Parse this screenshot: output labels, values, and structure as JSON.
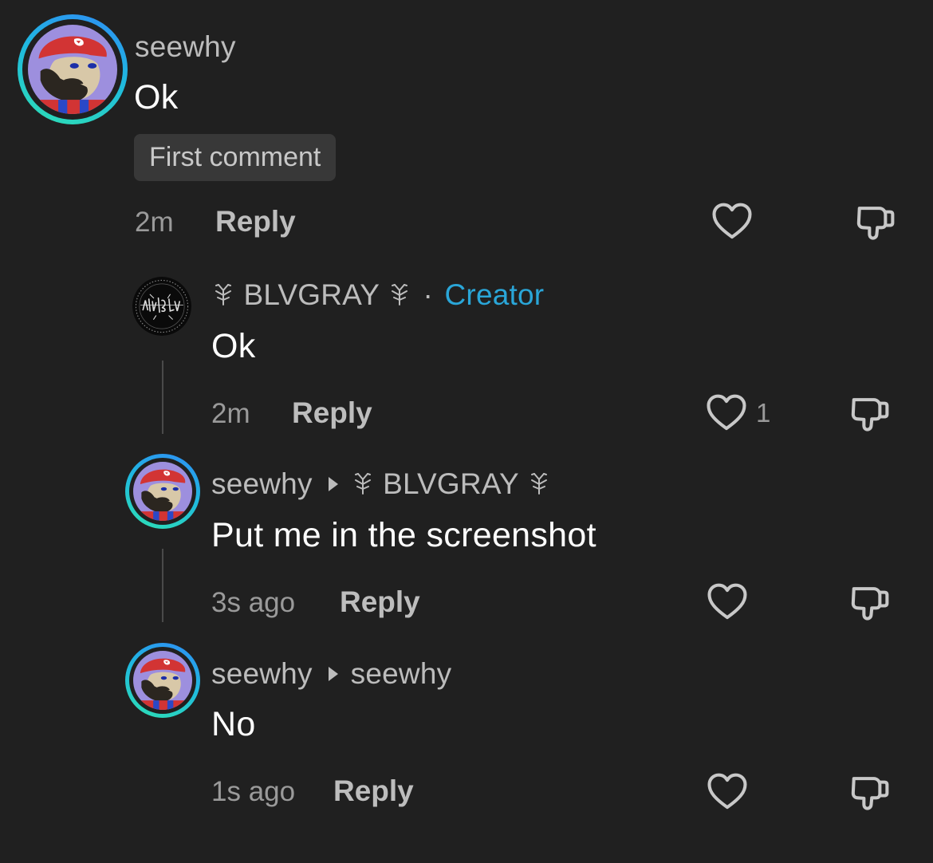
{
  "colors": {
    "background": "#202020",
    "creator_accent": "#2aa6d8",
    "avatar_ring_start": "#2f8cf5",
    "avatar_ring_end": "#2ee0b3"
  },
  "icons": {
    "reply_arrow": "caret-right-icon",
    "username_decoration": "sprout-icon",
    "like": "heart-outline-icon",
    "dislike": "thumbs-down-outline-icon"
  },
  "comments": [
    {
      "username": "seewhy",
      "text": "Ok",
      "badge": "First comment",
      "time": "2m",
      "reply_label": "Reply"
    },
    {
      "username": "BLVGRAY",
      "separator": "·",
      "role": "Creator",
      "text": "Ok",
      "time": "2m",
      "reply_label": "Reply",
      "like_count": "1"
    },
    {
      "username": "seewhy",
      "reply_to": "BLVGRAY",
      "text": "Put me in the screenshot",
      "time": "3s ago",
      "reply_label": "Reply"
    },
    {
      "username": "seewhy",
      "reply_to": "seewhy",
      "text": "No",
      "time": "1s ago",
      "reply_label": "Reply"
    }
  ]
}
